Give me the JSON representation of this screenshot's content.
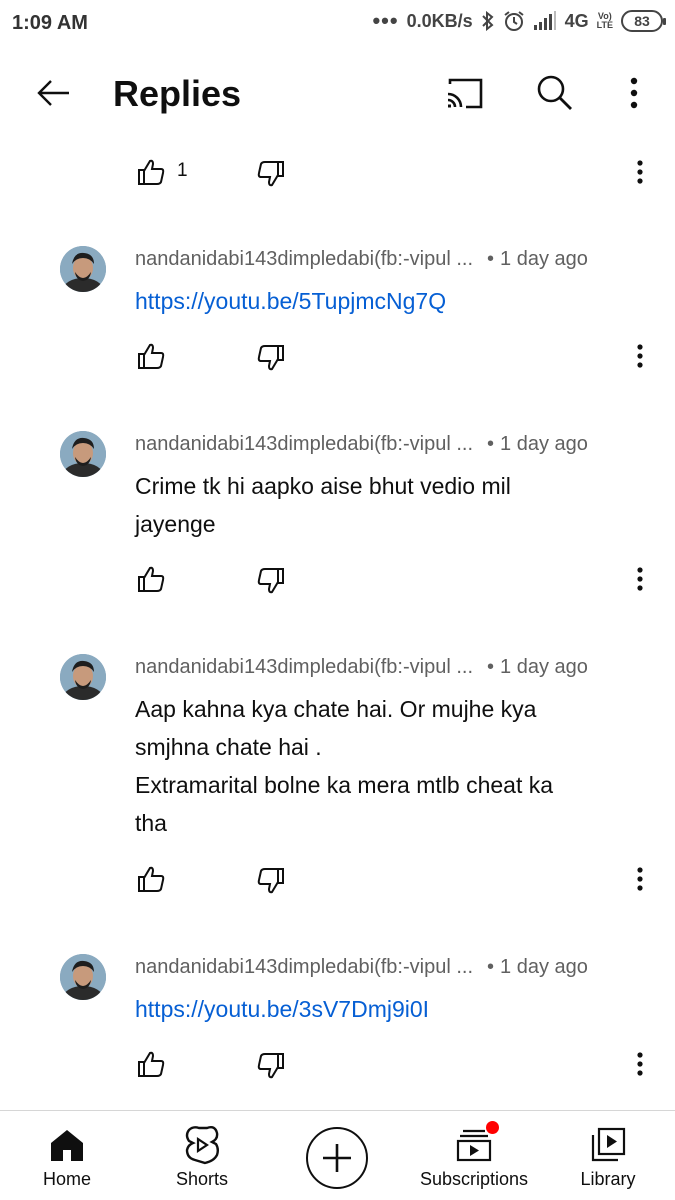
{
  "status_bar": {
    "time": "1:09 AM",
    "network_speed": "0.0KB/s",
    "network_type": "4G",
    "volte_top": "Vo)",
    "volte_bottom": "LTE",
    "battery": "83",
    "icons": [
      "dots-icon",
      "bluetooth-icon",
      "alarm-icon",
      "signal-icon"
    ]
  },
  "header": {
    "title": "Replies",
    "icons": [
      "back-arrow-icon",
      "cast-icon",
      "search-icon",
      "more-vert-icon"
    ]
  },
  "top_actions": {
    "like_count": "1"
  },
  "comments": [
    {
      "author": "nandanidabi143dimpledabi(fb:-vipul ...",
      "time": "1 day ago",
      "lines": [
        "https://youtu.be/5TupjmcNg7Q"
      ],
      "is_link": true
    },
    {
      "author": "nandanidabi143dimpledabi(fb:-vipul ...",
      "time": "1 day ago",
      "lines": [
        "Crime tk hi aapko aise bhut vedio mil",
        "jayenge"
      ],
      "is_link": false
    },
    {
      "author": "nandanidabi143dimpledabi(fb:-vipul ...",
      "time": "1 day ago",
      "lines": [
        "Aap kahna kya chate hai. Or mujhe kya",
        "smjhna chate hai .",
        "Extramarital bolne ka mera mtlb cheat ka",
        "tha"
      ],
      "is_link": false
    },
    {
      "author": "nandanidabi143dimpledabi(fb:-vipul ...",
      "time": "1 day ago",
      "lines": [
        "https://youtu.be/3sV7Dmj9i0I"
      ],
      "is_link": true
    }
  ],
  "bottom_nav": {
    "home": "Home",
    "shorts": "Shorts",
    "subscriptions": "Subscriptions",
    "library": "Library",
    "icons": [
      "home-icon",
      "shorts-icon",
      "create-icon",
      "subscriptions-icon",
      "library-icon"
    ]
  },
  "colors": {
    "link": "#065fd4",
    "meta": "#606060",
    "text": "#0f0f0f",
    "notification_dot": "#ff0000"
  }
}
